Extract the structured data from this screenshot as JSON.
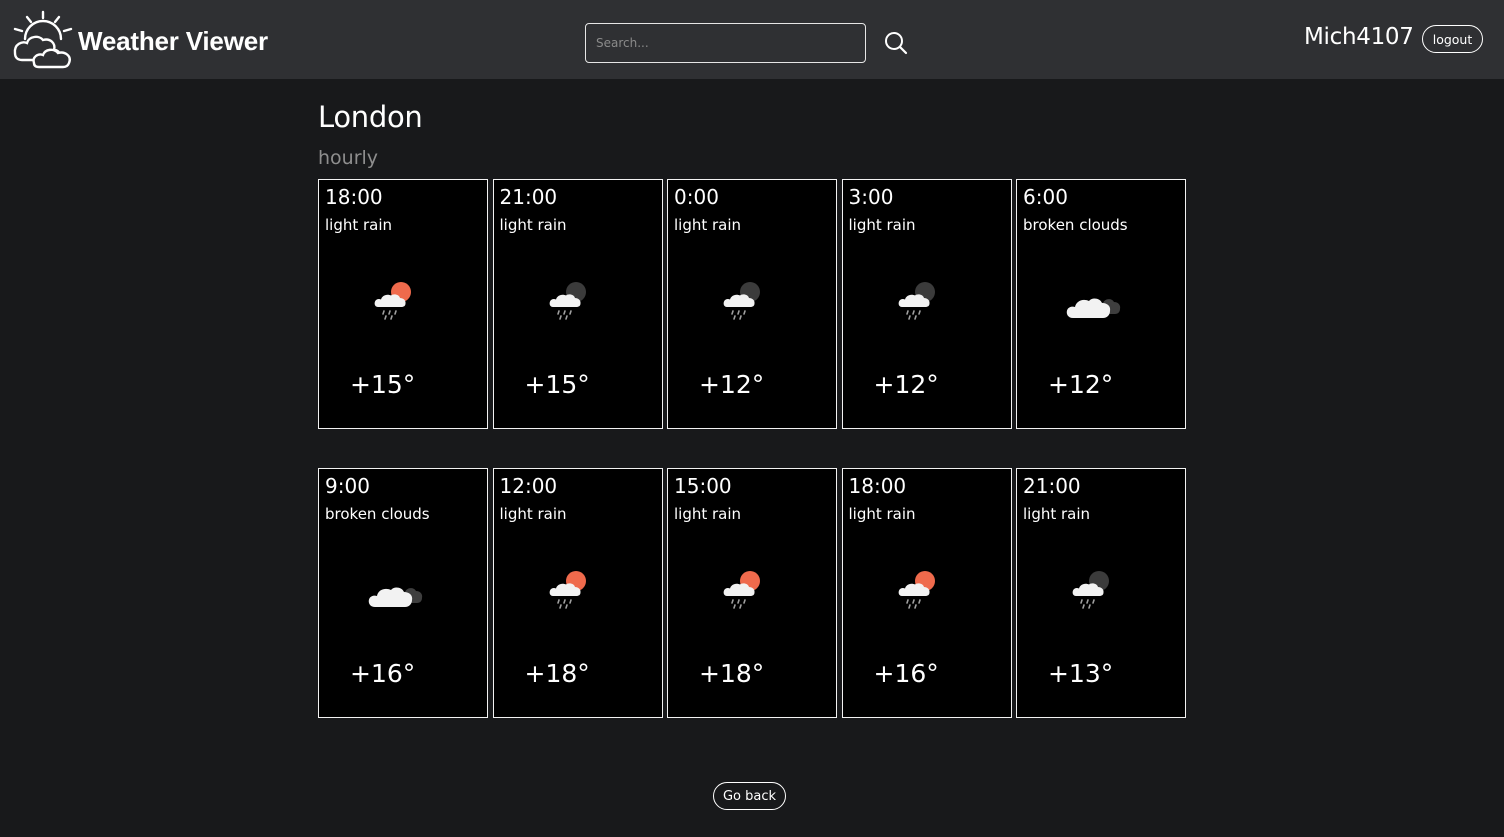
{
  "header": {
    "brand": "Weather Viewer",
    "search_placeholder": "Search...",
    "username": "Mich4107",
    "logout_label": "logout"
  },
  "location": {
    "city": "London",
    "mode": "hourly"
  },
  "forecast": [
    {
      "time": "18:00",
      "desc": "light rain",
      "temp": "+15°",
      "icon": "rain-day"
    },
    {
      "time": "21:00",
      "desc": "light rain",
      "temp": "+15°",
      "icon": "rain-night"
    },
    {
      "time": "0:00",
      "desc": "light rain",
      "temp": "+12°",
      "icon": "rain-night"
    },
    {
      "time": "3:00",
      "desc": "light rain",
      "temp": "+12°",
      "icon": "rain-night"
    },
    {
      "time": "6:00",
      "desc": "broken clouds",
      "temp": "+12°",
      "icon": "broken-clouds"
    },
    {
      "time": "9:00",
      "desc": "broken clouds",
      "temp": "+16°",
      "icon": "broken-clouds"
    },
    {
      "time": "12:00",
      "desc": "light rain",
      "temp": "+18°",
      "icon": "rain-day"
    },
    {
      "time": "15:00",
      "desc": "light rain",
      "temp": "+18°",
      "icon": "rain-day"
    },
    {
      "time": "18:00",
      "desc": "light rain",
      "temp": "+16°",
      "icon": "rain-day"
    },
    {
      "time": "21:00",
      "desc": "light rain",
      "temp": "+13°",
      "icon": "rain-night"
    }
  ],
  "footer": {
    "go_back_label": "Go back"
  },
  "colors": {
    "sun": "#ef6a4c",
    "moon": "#3b3b3b",
    "cloud": "#f2f2f2",
    "dark_cloud": "#3e3e3e",
    "rain": "#a0a0a0"
  }
}
